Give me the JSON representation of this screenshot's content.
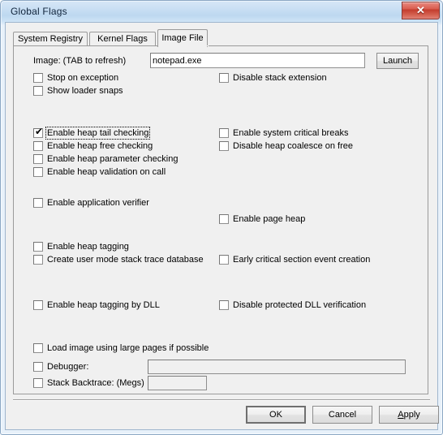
{
  "window": {
    "title": "Global Flags",
    "close_label": "✕"
  },
  "tabs": [
    {
      "label": "System Registry",
      "active": false
    },
    {
      "label": "Kernel Flags",
      "active": false
    },
    {
      "label": "Image File",
      "active": true
    }
  ],
  "image_row": {
    "label": "Image: (TAB to refresh)",
    "value": "notepad.exe",
    "placeholder": "",
    "launch_label": "Launch"
  },
  "checkboxes_left": [
    {
      "label": "Stop on exception",
      "checked": false,
      "focused": false
    },
    {
      "label": "Show loader snaps",
      "checked": false,
      "focused": false
    },
    {
      "label": "Enable heap tail checking",
      "checked": true,
      "focused": true
    },
    {
      "label": "Enable heap free checking",
      "checked": false,
      "focused": false
    },
    {
      "label": "Enable heap parameter checking",
      "checked": false,
      "focused": false
    },
    {
      "label": "Enable heap validation on call",
      "checked": false,
      "focused": false
    },
    {
      "label": "Enable application verifier",
      "checked": false,
      "focused": false
    },
    {
      "label": "Enable heap tagging",
      "checked": false,
      "focused": false
    },
    {
      "label": "Create user mode stack trace database",
      "checked": false,
      "focused": false
    },
    {
      "label": "Enable heap tagging by DLL",
      "checked": false,
      "focused": false
    },
    {
      "label": "Load image using large pages if possible",
      "checked": false,
      "focused": false
    }
  ],
  "checkboxes_right": [
    {
      "label": "Disable stack extension",
      "checked": false,
      "focused": false
    },
    {
      "label": "Enable system critical breaks",
      "checked": false,
      "focused": false
    },
    {
      "label": "Disable heap coalesce on free",
      "checked": false,
      "focused": false
    },
    {
      "label": "Enable page heap",
      "checked": false,
      "focused": false
    },
    {
      "label": "Early critical section event creation",
      "checked": false,
      "focused": false
    },
    {
      "label": "Disable protected DLL verification",
      "checked": false,
      "focused": false
    }
  ],
  "debugger_row": {
    "label": "Debugger:",
    "checked": false,
    "value": "",
    "enabled": false
  },
  "stack_backtrace_row": {
    "label": "Stack Backtrace: (Megs)",
    "checked": false,
    "value": "",
    "enabled": false
  },
  "buttons": {
    "ok": "OK",
    "cancel": "Cancel",
    "apply_accel": "A",
    "apply_rest": "pply"
  },
  "colors": {
    "dialog_bg": "#f0f0f0",
    "frame": "#9fb6cd",
    "close_red": "#c23b2c",
    "text": "#000000"
  }
}
